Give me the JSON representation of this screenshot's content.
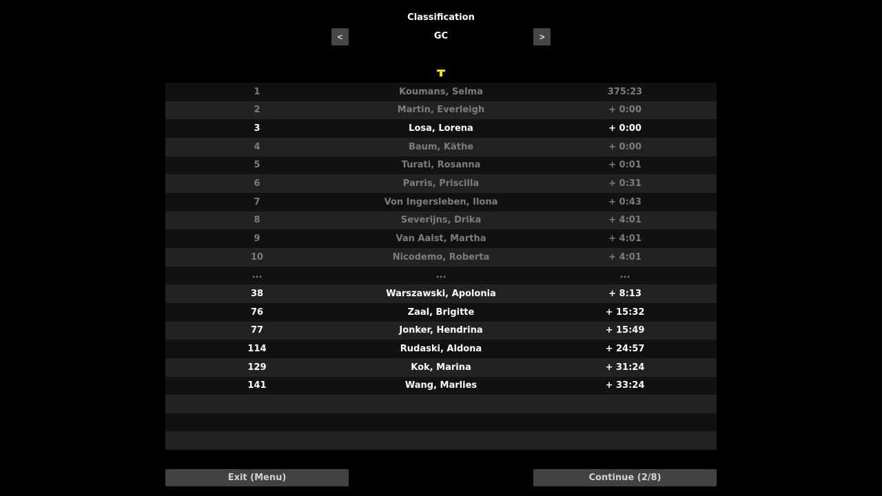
{
  "header": {
    "title": "Classification",
    "classification": "GC",
    "prev_label": "<",
    "next_label": ">"
  },
  "leader_jersey_color": "#ffe000",
  "rows": [
    {
      "pos": "1",
      "name": "Koumans, Selma",
      "time": "375:23",
      "highlight": false
    },
    {
      "pos": "2",
      "name": "Martin, Everleigh",
      "time": "+ 0:00",
      "highlight": false
    },
    {
      "pos": "3",
      "name": "Losa, Lorena",
      "time": "+ 0:00",
      "highlight": true
    },
    {
      "pos": "4",
      "name": "Baum, Käthe",
      "time": "+ 0:00",
      "highlight": false
    },
    {
      "pos": "5",
      "name": "Turati, Rosanna",
      "time": "+ 0:01",
      "highlight": false
    },
    {
      "pos": "6",
      "name": "Parris, Priscilla",
      "time": "+ 0:31",
      "highlight": false
    },
    {
      "pos": "7",
      "name": "Von Ingersleben, Ilona",
      "time": "+ 0:43",
      "highlight": false
    },
    {
      "pos": "8",
      "name": "Severijns, Drika",
      "time": "+ 4:01",
      "highlight": false
    },
    {
      "pos": "9",
      "name": "Van Aalst, Martha",
      "time": "+ 4:01",
      "highlight": false
    },
    {
      "pos": "10",
      "name": "Nicodemo, Roberta",
      "time": "+ 4:01",
      "highlight": false
    },
    {
      "pos": "...",
      "name": "...",
      "time": "...",
      "highlight": false
    },
    {
      "pos": "38",
      "name": "Warszawski, Apolonia",
      "time": "+ 8:13",
      "highlight": true
    },
    {
      "pos": "76",
      "name": "Zaal, Brigitte",
      "time": "+ 15:32",
      "highlight": true
    },
    {
      "pos": "77",
      "name": "Jonker, Hendrina",
      "time": "+ 15:49",
      "highlight": true
    },
    {
      "pos": "114",
      "name": "Rudaski, Aldona",
      "time": "+ 24:57",
      "highlight": true
    },
    {
      "pos": "129",
      "name": "Kok, Marina",
      "time": "+ 31:24",
      "highlight": true
    },
    {
      "pos": "141",
      "name": "Wang, Marlies",
      "time": "+ 33:24",
      "highlight": true
    },
    {
      "pos": "",
      "name": "",
      "time": "",
      "highlight": false
    },
    {
      "pos": "",
      "name": "",
      "time": "",
      "highlight": false
    },
    {
      "pos": "",
      "name": "",
      "time": "",
      "highlight": false
    }
  ],
  "footer": {
    "exit_label": "Exit (Menu)",
    "continue_label": "Continue (2/8)"
  }
}
